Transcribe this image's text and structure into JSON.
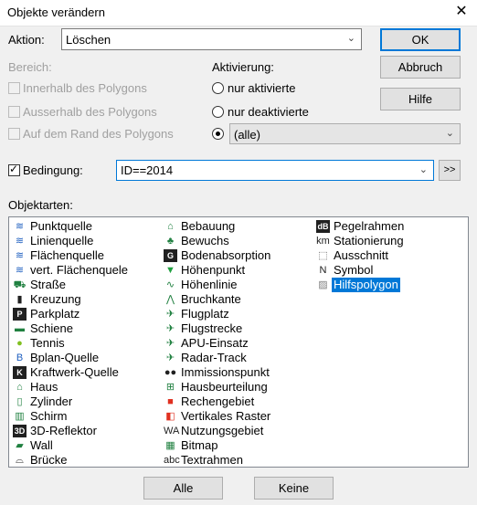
{
  "window": {
    "title": "Objekte verändern",
    "close_symbol": "✕"
  },
  "aktion": {
    "label": "Aktion:",
    "value": "Löschen"
  },
  "buttons": {
    "ok": "OK",
    "abbruch": "Abbruch",
    "hilfe": "Hilfe",
    "alle": "Alle",
    "keine": "Keine",
    "expand": ">>"
  },
  "bereich": {
    "label": "Bereich:",
    "options": [
      "Innerhalb des Polygons",
      "Ausserhalb des Polygons",
      "Auf dem Rand des Polygons"
    ]
  },
  "aktivierung": {
    "label": "Aktivierung:",
    "options": [
      "nur aktivierte",
      "nur deaktivierte"
    ],
    "combo_value": "(alle)"
  },
  "bedingung": {
    "label": "Bedingung:",
    "value": "ID==2014",
    "checked": true
  },
  "objektarten": {
    "label": "Objektarten:",
    "col1": [
      {
        "icon": "source-icon",
        "glyph": "≋",
        "color": "#2060c0",
        "label": "Punktquelle"
      },
      {
        "icon": "source-icon",
        "glyph": "≋",
        "color": "#2060c0",
        "label": "Linienquelle"
      },
      {
        "icon": "source-icon",
        "glyph": "≋",
        "color": "#2060c0",
        "label": "Flächenquelle"
      },
      {
        "icon": "source-icon",
        "glyph": "≋",
        "color": "#2060c0",
        "label": "vert. Flächenquele"
      },
      {
        "icon": "road-icon",
        "glyph": "⛟",
        "color": "#208040",
        "label": "Straße"
      },
      {
        "icon": "traffic-light-icon",
        "glyph": "▮",
        "color": "#202020",
        "label": "Kreuzung"
      },
      {
        "icon": "parking-icon",
        "glyph": "P",
        "color": "#ffffff",
        "label": "Parkplatz"
      },
      {
        "icon": "train-icon",
        "glyph": "▬",
        "color": "#208040",
        "label": "Schiene"
      },
      {
        "icon": "tennis-icon",
        "glyph": "●",
        "color": "#80c020",
        "label": "Tennis"
      },
      {
        "icon": "plan-icon",
        "glyph": "B",
        "color": "#2060c0",
        "label": "Bplan-Quelle"
      },
      {
        "icon": "powerplant-icon",
        "glyph": "K",
        "color": "#ffffff",
        "label": "Kraftwerk-Quelle"
      },
      {
        "icon": "house-icon",
        "glyph": "⌂",
        "color": "#208040",
        "label": "Haus"
      },
      {
        "icon": "cylinder-icon",
        "glyph": "▯",
        "color": "#208040",
        "label": "Zylinder"
      },
      {
        "icon": "screen-icon",
        "glyph": "▥",
        "color": "#208040",
        "label": "Schirm"
      },
      {
        "icon": "reflector-icon",
        "glyph": "3D",
        "color": "#ffffff",
        "label": "3D-Reflektor"
      },
      {
        "icon": "wall-icon",
        "glyph": "▰",
        "color": "#208040",
        "label": "Wall"
      },
      {
        "icon": "bridge-icon",
        "glyph": "⌓",
        "color": "#202020",
        "label": "Brücke"
      }
    ],
    "col2": [
      {
        "icon": "building-icon",
        "glyph": "⌂",
        "color": "#208040",
        "label": "Bebauung"
      },
      {
        "icon": "vegetation-icon",
        "glyph": "♣",
        "color": "#208040",
        "label": "Bewuchs"
      },
      {
        "icon": "ground-absorption-icon",
        "glyph": "G",
        "color": "#ffffff",
        "label": "Bodenabsorption"
      },
      {
        "icon": "height-point-icon",
        "glyph": "▼",
        "color": "#20a040",
        "label": "Höhenpunkt"
      },
      {
        "icon": "height-line-icon",
        "glyph": "∿",
        "color": "#208040",
        "label": "Höhenlinie"
      },
      {
        "icon": "break-line-icon",
        "glyph": "⋀",
        "color": "#208040",
        "label": "Bruchkante"
      },
      {
        "icon": "airport-icon",
        "glyph": "✈",
        "color": "#208040",
        "label": "Flugplatz"
      },
      {
        "icon": "flight-route-icon",
        "glyph": "✈",
        "color": "#208040",
        "label": "Flugstrecke"
      },
      {
        "icon": "apu-icon",
        "glyph": "✈",
        "color": "#208040",
        "label": "APU-Einsatz"
      },
      {
        "icon": "radar-track-icon",
        "glyph": "✈",
        "color": "#208040",
        "label": "Radar-Track"
      },
      {
        "icon": "immission-point-icon",
        "glyph": "●●",
        "color": "#202020",
        "label": "Immissionspunkt"
      },
      {
        "icon": "house-assessment-icon",
        "glyph": "⊞",
        "color": "#208040",
        "label": "Hausbeurteilung"
      },
      {
        "icon": "calc-area-icon",
        "glyph": "■",
        "color": "#e03020",
        "label": "Rechengebiet"
      },
      {
        "icon": "vertical-grid-icon",
        "glyph": "◧",
        "color": "#e03020",
        "label": "Vertikales Raster"
      },
      {
        "icon": "usage-area-icon",
        "glyph": "WA",
        "color": "#202020",
        "label": "Nutzungsgebiet"
      },
      {
        "icon": "bitmap-icon",
        "glyph": "▦",
        "color": "#208040",
        "label": "Bitmap"
      },
      {
        "icon": "text-frame-icon",
        "glyph": "abc",
        "color": "#202020",
        "label": "Textrahmen"
      }
    ],
    "col3": [
      {
        "icon": "gauge-frame-icon",
        "glyph": "dB",
        "color": "#ffffff",
        "label": "Pegelrahmen"
      },
      {
        "icon": "station-icon",
        "glyph": "km",
        "color": "#202020",
        "label": "Stationierung"
      },
      {
        "icon": "cutout-icon",
        "glyph": "⬚",
        "color": "#606060",
        "label": "Ausschnitt"
      },
      {
        "icon": "symbol-icon",
        "glyph": "N",
        "color": "#202020",
        "label": "Symbol"
      },
      {
        "icon": "helper-polygon-icon",
        "glyph": "▨",
        "color": "#808080",
        "label": "Hilfspolygon",
        "selected": true
      }
    ]
  }
}
